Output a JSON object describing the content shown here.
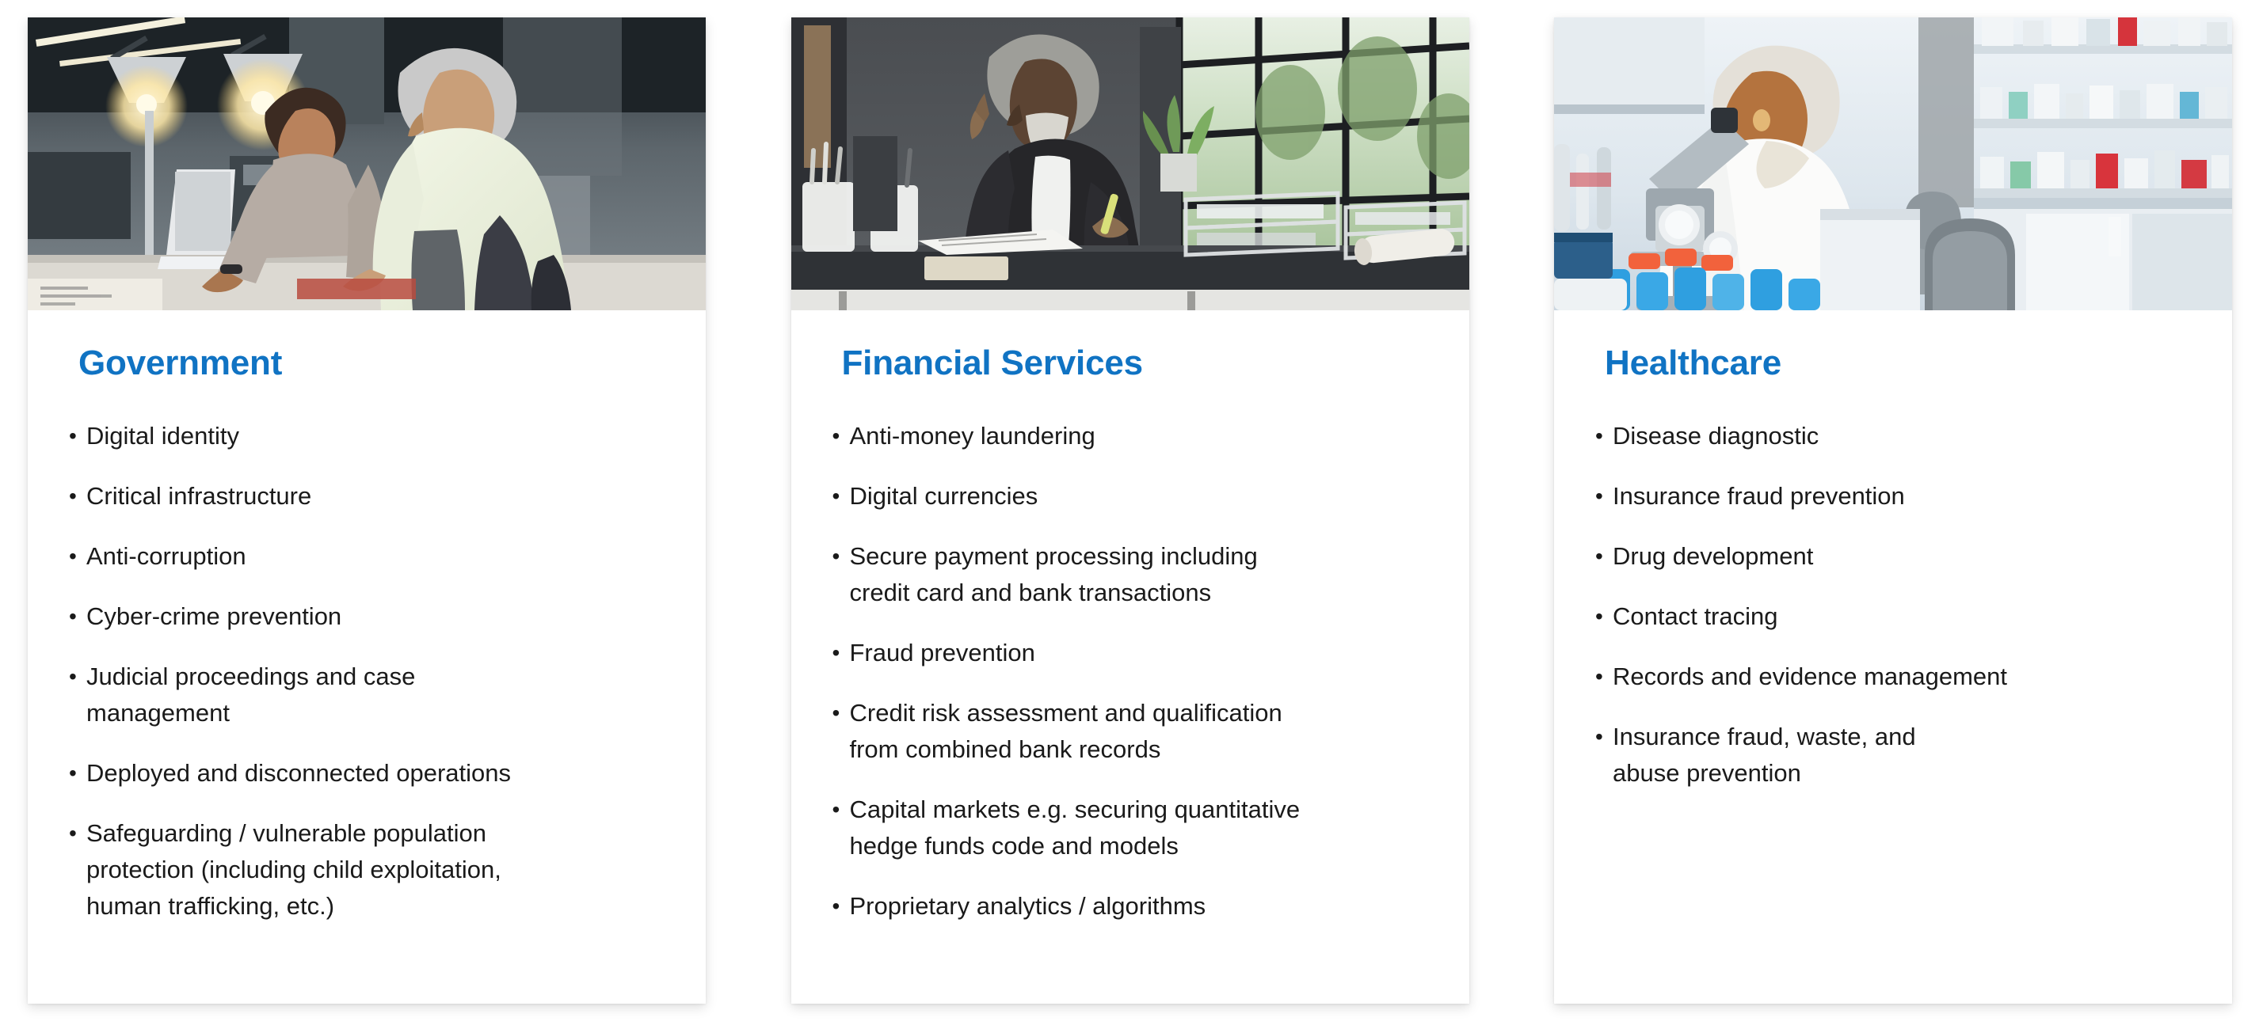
{
  "slide": {
    "background_color": "#ffffff",
    "accent_color": "#1073c3",
    "text_color": "#1a1a1a"
  },
  "cards": [
    {
      "id": "government",
      "title": "Government",
      "image": {
        "name": "government-office-photo",
        "alt": "Two colleagues in an office leaning over a desk with lamps, looking at a laptop"
      },
      "bullets": [
        [
          "Digital identity"
        ],
        [
          "Critical infrastructure"
        ],
        [
          "Anti-corruption"
        ],
        [
          "Cyber-crime prevention"
        ],
        [
          "Judicial proceedings and case",
          "management"
        ],
        [
          "Deployed and disconnected operations"
        ],
        [
          "Safeguarding / vulnerable population",
          "protection (including child exploitation,",
          "human trafficking, etc.)"
        ]
      ]
    },
    {
      "id": "financial-services",
      "title": "Financial Services",
      "image": {
        "name": "financial-services-office-photo",
        "alt": "Bearded man in a dark blazer sitting at a desk reviewing documents near large windows"
      },
      "bullets": [
        [
          "Anti-money laundering"
        ],
        [
          "Digital currencies"
        ],
        [
          "Secure payment processing including",
          "credit card and bank transactions"
        ],
        [
          "Fraud prevention"
        ],
        [
          "Credit risk assessment and qualification",
          "from combined bank records"
        ],
        [
          "Capital markets e.g. securing quantitative",
          "hedge funds code and models"
        ],
        [
          "Proprietary analytics / algorithms"
        ]
      ]
    },
    {
      "id": "healthcare",
      "title": "Healthcare",
      "image": {
        "name": "healthcare-laboratory-photo",
        "alt": "Scientist in a white lab coat looking into a microscope in a laboratory"
      },
      "bullets": [
        [
          "Disease diagnostic"
        ],
        [
          "Insurance fraud prevention"
        ],
        [
          "Drug development"
        ],
        [
          "Contact tracing"
        ],
        [
          "Records and evidence management"
        ],
        [
          "Insurance fraud, waste, and",
          "abuse prevention"
        ]
      ]
    }
  ]
}
